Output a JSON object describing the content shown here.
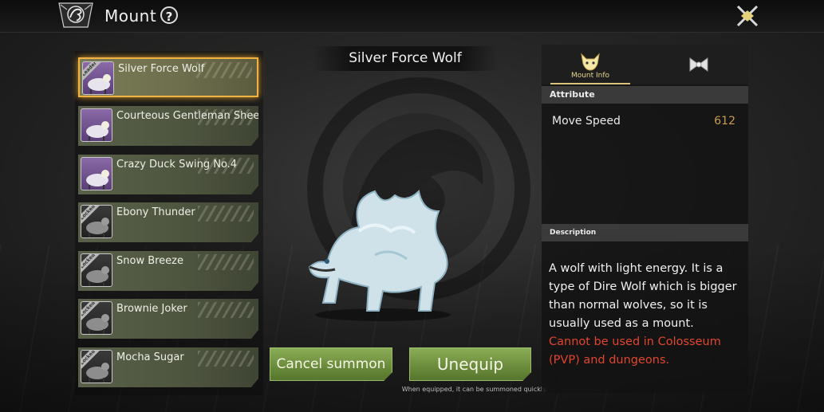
{
  "header": {
    "title": "Mount",
    "help_label": "?"
  },
  "mount_list": [
    {
      "name": "Silver Force Wolf",
      "selected": true,
      "thumb": "purple",
      "badge": "Leader",
      "icon": "wolf-thumbnail-icon"
    },
    {
      "name": "Courteous Gentleman Sheep",
      "selected": false,
      "thumb": "purple",
      "badge": "",
      "icon": "sheep-thumbnail-icon"
    },
    {
      "name": "Crazy Duck Swing No.4",
      "selected": false,
      "thumb": "purple",
      "badge": "",
      "icon": "duck-swing-thumbnail-icon"
    },
    {
      "name": "Ebony Thunder",
      "selected": false,
      "thumb": "gray",
      "badge": "Locked",
      "icon": "horse-thumbnail-icon"
    },
    {
      "name": "Snow Breeze",
      "selected": false,
      "thumb": "gray",
      "badge": "Locked",
      "icon": "horse-thumbnail-icon"
    },
    {
      "name": "Brownie Joker",
      "selected": false,
      "thumb": "gray",
      "badge": "Locked",
      "icon": "horse-thumbnail-icon"
    },
    {
      "name": "Mocha Sugar",
      "selected": false,
      "thumb": "gray",
      "badge": "Locked",
      "icon": "horse-thumbnail-icon"
    }
  ],
  "preview": {
    "mount_name": "Silver Force Wolf",
    "cancel_label": "Cancel summon",
    "unequip_label": "Unequip",
    "hint": "When equipped, it can be summoned quickly."
  },
  "info_panel": {
    "tab_mount_info": "Mount Info",
    "attribute_header": "Attribute",
    "attributes": [
      {
        "name": "Move Speed",
        "value": "612"
      }
    ],
    "description_header": "Description",
    "description": "A wolf with light energy. It is a type of Dire Wolf which is bigger than normal wolves, so it is usually used as a mount.",
    "restriction": "Cannot be used in Colosseum (PVP) and dungeons."
  },
  "colors": {
    "accent_gold": "#f2b342",
    "value_gold": "#c89c55",
    "button_green": "#6c8d3c",
    "warning_red": "#e2452d"
  }
}
